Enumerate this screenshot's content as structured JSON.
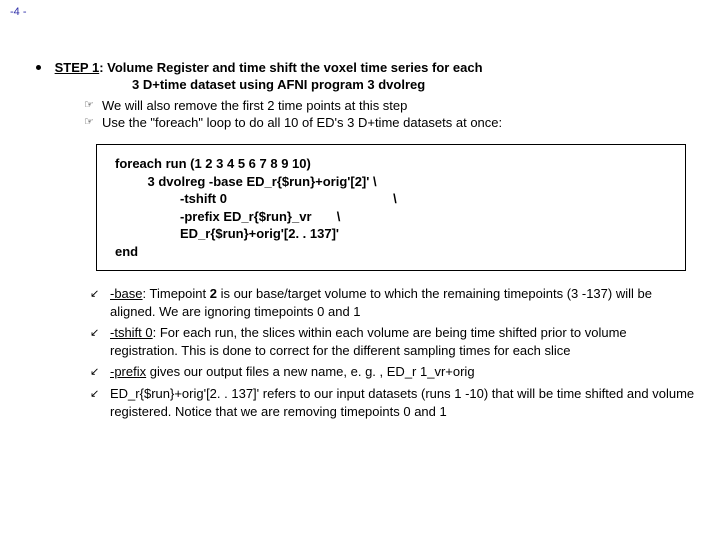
{
  "page_number": "-4 -",
  "step": {
    "label": "STEP 1",
    "line1_rest": ": Volume Register and time shift the voxel time series for each",
    "line2": "3 D+time dataset using AFNI program ",
    "program": "3 dvolreg"
  },
  "sub": {
    "a": "We will also remove the first 2 time points at this step",
    "b": "Use the \"foreach\" loop to do all 10 of ED's 3 D+time datasets at once:"
  },
  "code": {
    "l1": "foreach run (1 2 3 4 5 6 7 8 9 10)",
    "l2": "         3 dvolreg -base ED_r{$run}+orig'[2]' \\",
    "l3": "                  -tshift 0                                              \\",
    "l4": "                  -prefix ED_r{$run}_vr       \\",
    "l5": "                  ED_r{$run}+orig'[2. . 137]'",
    "l6": "end"
  },
  "notes": {
    "n1a": "-base",
    "n1b": ": Timepoint ",
    "n1c": "2",
    "n1d": " is our base/target volume to which the remaining timepoints (3 -137) will be aligned.  We are ignoring timepoints 0 and 1",
    "n2a": "-tshift 0",
    "n2b": ": For each run, the slices within each volume are being time shifted prior to volume registration.  This is done to correct for the different sampling times for each slice",
    "n3a": "-prefix",
    "n3b": " gives our output files a new name, e. g. , ED_r 1_vr+orig",
    "n4": "ED_r{$run}+orig'[2. . 137]' refers to our input datasets (runs 1 -10) that will be time shifted and volume registered.  Notice that we are removing timepoints 0 and 1"
  }
}
